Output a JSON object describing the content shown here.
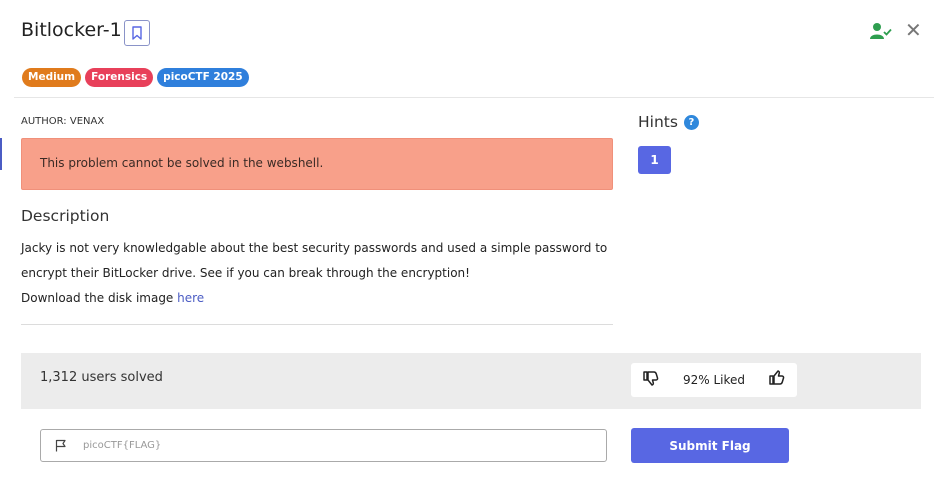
{
  "header": {
    "title": "Bitlocker-1",
    "bookmark_icon": "bookmark-icon",
    "user_check_icon": "user-check-icon",
    "close_icon": "close-icon",
    "close_glyph": "✕"
  },
  "tags": [
    {
      "label": "Medium",
      "color": "#e07b1c"
    },
    {
      "label": "Forensics",
      "color": "#e8405a"
    },
    {
      "label": "picoCTF 2025",
      "color": "#2f7fdc"
    }
  ],
  "problem": {
    "author": "AUTHOR: VENAX",
    "alert": "This problem cannot be solved in the webshell.",
    "description_heading": "Description",
    "description_line1": "Jacky is not very knowledgable about the best security passwords and used a simple password to",
    "description_line2": "encrypt their BitLocker drive. See if you can break through the encryption!",
    "download_prefix": "Download the disk image ",
    "download_link": "here"
  },
  "hints": {
    "heading": "Hints",
    "help_glyph": "?",
    "items": [
      "1"
    ]
  },
  "stats": {
    "solved": "1,312 users solved",
    "liked": "92% Liked"
  },
  "flag": {
    "placeholder": "picoCTF{FLAG}",
    "submit_label": "Submit Flag"
  },
  "colors": {
    "accent": "#5867e3",
    "alert_bg": "#f8a08a",
    "success": "#2e9e4f"
  }
}
